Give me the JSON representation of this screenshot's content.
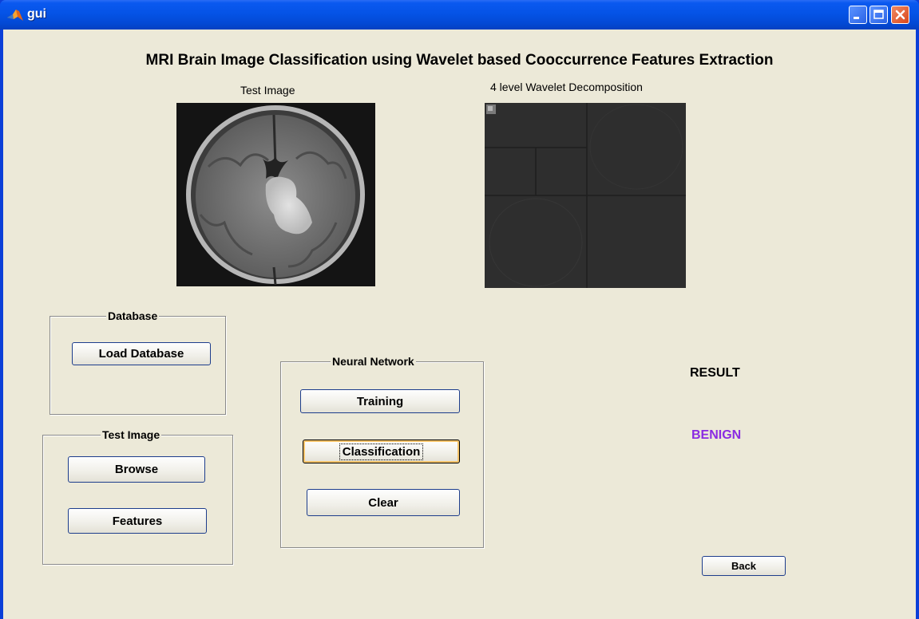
{
  "window": {
    "title": "gui",
    "controls": [
      "minimize-icon",
      "maximize-icon",
      "close-icon"
    ]
  },
  "heading": "MRI Brain Image Classification using Wavelet based Cooccurrence Features Extraction",
  "images": {
    "test_label": "Test Image",
    "wavelet_label": "4 level Wavelet Decomposition"
  },
  "panels": {
    "database": {
      "title": "Database",
      "load_button": "Load Database"
    },
    "test_image": {
      "title": "Test Image",
      "browse_button": "Browse",
      "features_button": "Features"
    },
    "neural_network": {
      "title": "Neural Network",
      "training_button": "Training",
      "classification_button": "Classification",
      "clear_button": "Clear"
    }
  },
  "result": {
    "label": "RESULT",
    "value": "BENIGN",
    "value_color": "#8a2be2"
  },
  "back_button": "Back"
}
